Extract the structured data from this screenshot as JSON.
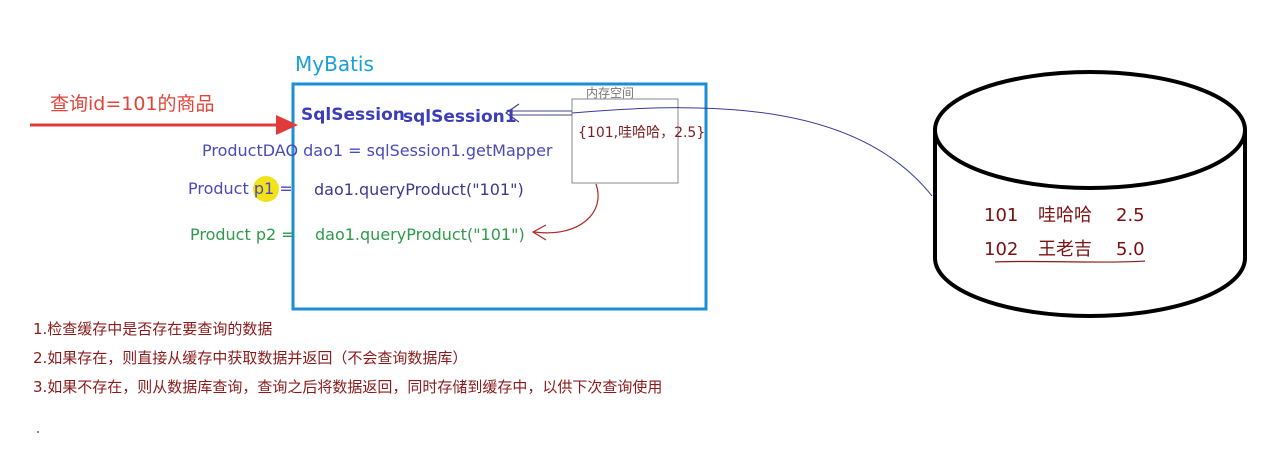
{
  "title": "MyBatis",
  "query_label": "查询id=101的商品",
  "session": {
    "type_label": "SqlSession",
    "var_label": "sqlSession1",
    "memory_label": "内存空间",
    "cached_entry": "{101,哇哈哈，2.5}"
  },
  "code": {
    "mapper_line": "ProductDAO dao1 = sqlSession1.getMapper",
    "p1_label": "Product p1 =",
    "p1_call": "dao1.queryProduct(\"101\")",
    "p2_label": "Product p2 =",
    "p2_call": "dao1.queryProduct(\"101\")"
  },
  "database": {
    "rows": [
      {
        "id": "101",
        "name": "哇哈哈",
        "price": "2.5"
      },
      {
        "id": "102",
        "name": "王老吉",
        "price": "5.0"
      }
    ]
  },
  "notes": [
    "1.检查缓存中是否存在要查询的数据",
    "2.如果存在，则直接从缓存中获取数据并返回（不会查询数据库）",
    "3.如果不存在，则从数据库查询，查询之后将数据返回，同时存储到缓存中，以供下次查询使用"
  ],
  "colors": {
    "mybatis_box": "#1a8fd6",
    "query_arrow": "#e03a3a",
    "session_text": "#3d3db8",
    "p2_text": "#2e9a4a",
    "db_text": "#7a1010",
    "highlight": "#f2e21a"
  }
}
